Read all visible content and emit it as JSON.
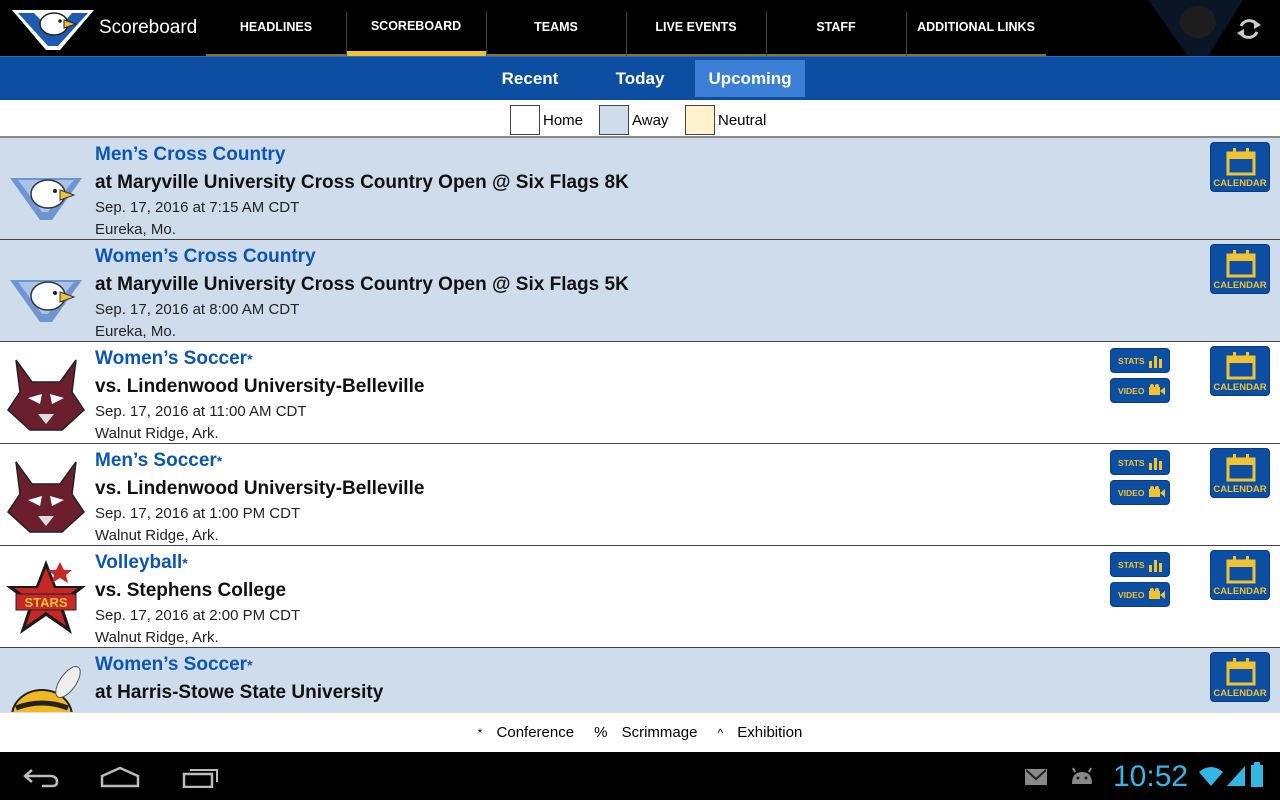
{
  "app": {
    "title": "Scoreboard",
    "logo": "eagle-logo",
    "refresh_icon": "refresh-icon"
  },
  "tabs": [
    "HEADLINES",
    "SCOREBOARD",
    "TEAMS",
    "LIVE EVENTS",
    "STAFF",
    "ADDITIONAL LINKS"
  ],
  "active_tab": "SCOREBOARD",
  "subtabs": [
    "Recent",
    "Today",
    "Upcoming"
  ],
  "active_subtab": "Upcoming",
  "legend": [
    {
      "label": "Home",
      "color": "#ffffff"
    },
    {
      "label": "Away",
      "color": "#cfdcec"
    },
    {
      "label": "Neutral",
      "color": "#fff2cc"
    }
  ],
  "events": [
    {
      "sport": "Men’s Cross Country",
      "mark": "",
      "opponent": "at Maryville University Cross Country Open @ Six Flags 8K",
      "datetime": "Sep. 17, 2016 at 7:15 AM CDT",
      "location": "Eureka, Mo.",
      "venue": "away",
      "logo": "eagle-logo",
      "stats": false,
      "video": false,
      "calendar": "CALENDAR"
    },
    {
      "sport": "Women’s Cross Country",
      "mark": "",
      "opponent": "at Maryville University Cross Country Open @ Six Flags 5K",
      "datetime": "Sep. 17, 2016 at 8:00 AM CDT",
      "location": "Eureka, Mo.",
      "venue": "away",
      "logo": "eagle-logo",
      "stats": false,
      "video": false,
      "calendar": "CALENDAR"
    },
    {
      "sport": "Women’s Soccer",
      "mark": "*",
      "opponent": "vs. Lindenwood University-Belleville",
      "datetime": "Sep. 17, 2016 at 11:00 AM CDT",
      "location": "Walnut Ridge, Ark.",
      "venue": "home",
      "logo": "lynx-logo",
      "stats": true,
      "video": true,
      "calendar": "CALENDAR"
    },
    {
      "sport": "Men’s Soccer",
      "mark": "*",
      "opponent": "vs. Lindenwood University-Belleville",
      "datetime": "Sep. 17, 2016 at 1:00 PM CDT",
      "location": "Walnut Ridge, Ark.",
      "venue": "home",
      "logo": "lynx-logo",
      "stats": true,
      "video": true,
      "calendar": "CALENDAR"
    },
    {
      "sport": "Volleyball",
      "mark": "*",
      "opponent": "vs. Stephens College",
      "datetime": "Sep. 17, 2016 at 2:00 PM CDT",
      "location": "Walnut Ridge, Ark.",
      "venue": "home",
      "logo": "stars-logo",
      "stats": true,
      "video": true,
      "calendar": "CALENDAR"
    },
    {
      "sport": "Women’s Soccer",
      "mark": "*",
      "opponent": "at Harris-Stowe State University",
      "datetime": "",
      "location": "",
      "venue": "away",
      "logo": "hornet-logo",
      "stats": false,
      "video": false,
      "calendar": "CALENDAR"
    }
  ],
  "buttons": {
    "stats": "STATS",
    "video": "VIDEO"
  },
  "footnote": {
    "conference_sym": "*",
    "conference": "Conference",
    "scrimmage_sym": "%",
    "scrimmage": "Scrimmage",
    "exhibition_sym": "^",
    "exhibition": "Exhibition"
  },
  "system": {
    "time": "10:52",
    "icons": [
      "back-icon",
      "home-icon",
      "recent-apps-icon",
      "gmail-icon",
      "android-icon",
      "wifi-icon",
      "signal-icon",
      "battery-icon"
    ]
  },
  "colors": {
    "brand_blue": "#0b4ea2",
    "accent_gold": "#f1c232",
    "clock": "#33b5e5"
  }
}
